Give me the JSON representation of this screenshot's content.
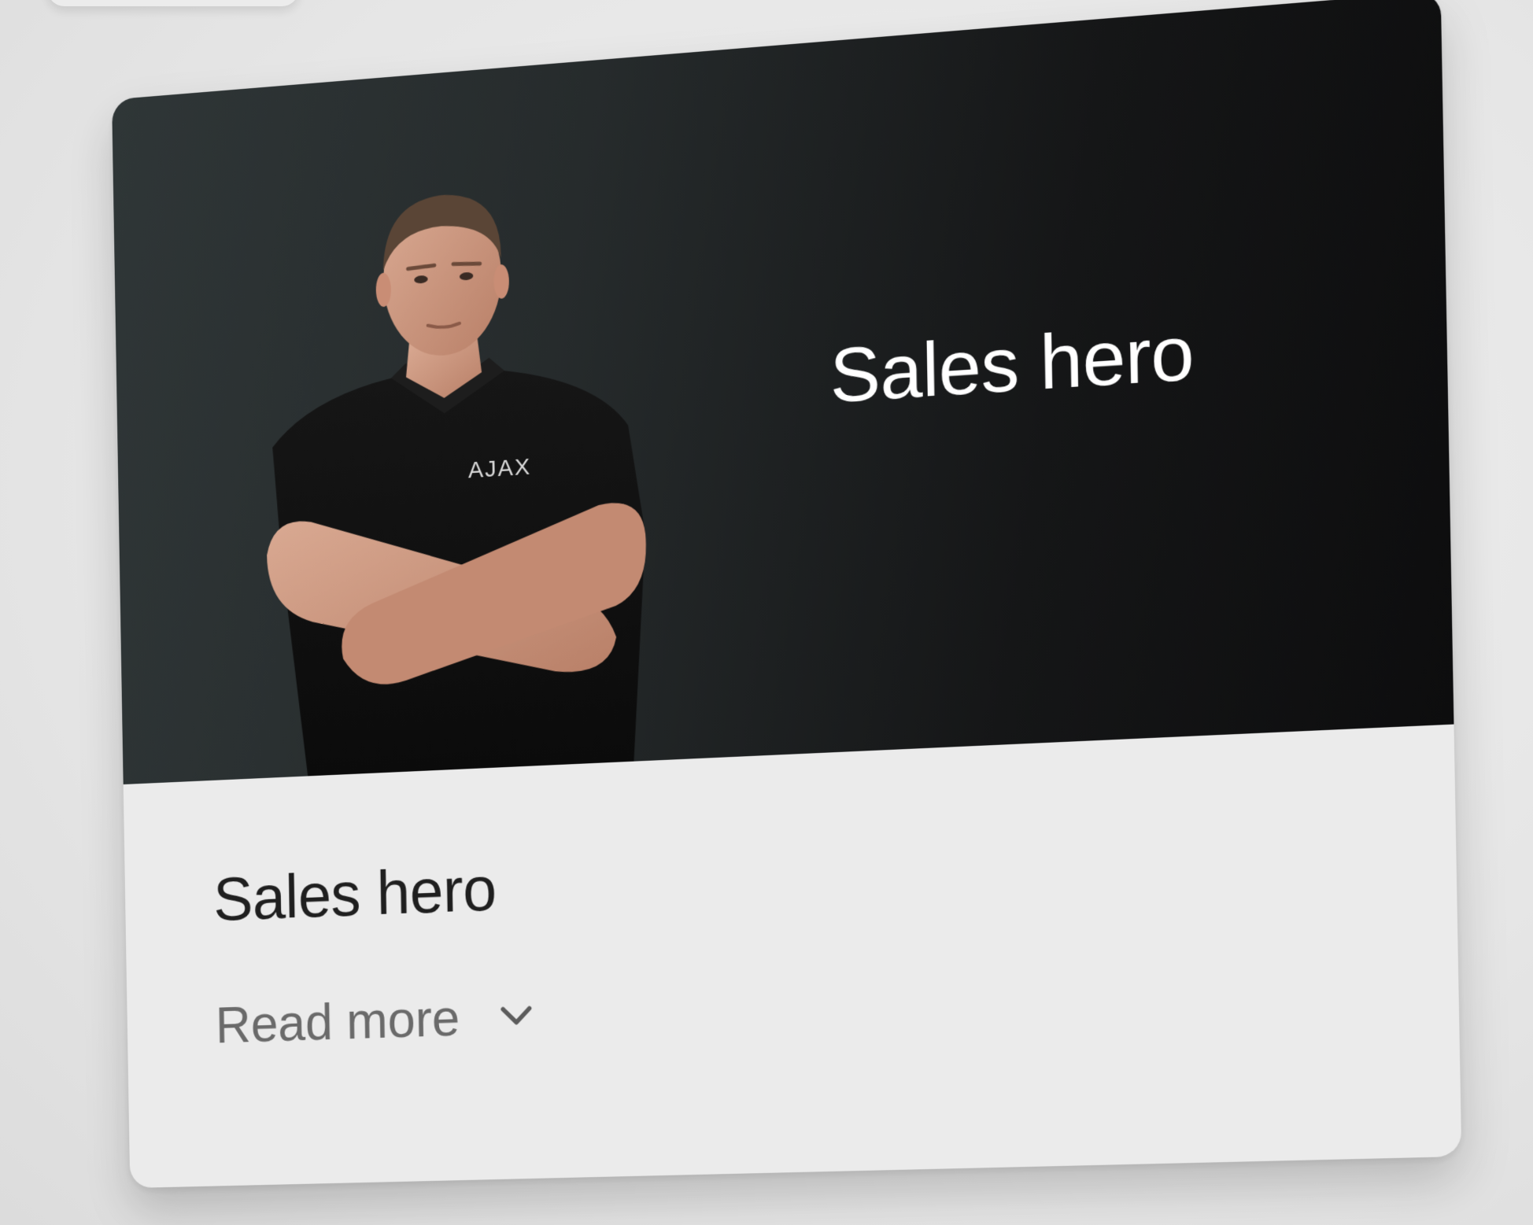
{
  "card": {
    "banner_title": "Sales hero",
    "title": "Sales hero",
    "read_more_label": "Read more",
    "shirt_logo": "AJAX"
  },
  "icons": {
    "expand": "chevron-down-icon"
  },
  "colors": {
    "banner_dark": "#151617",
    "banner_light": "#2f3637",
    "card_background": "#ebebeb",
    "title_text": "#1f1f1f",
    "link_text": "#6a6a6a"
  }
}
